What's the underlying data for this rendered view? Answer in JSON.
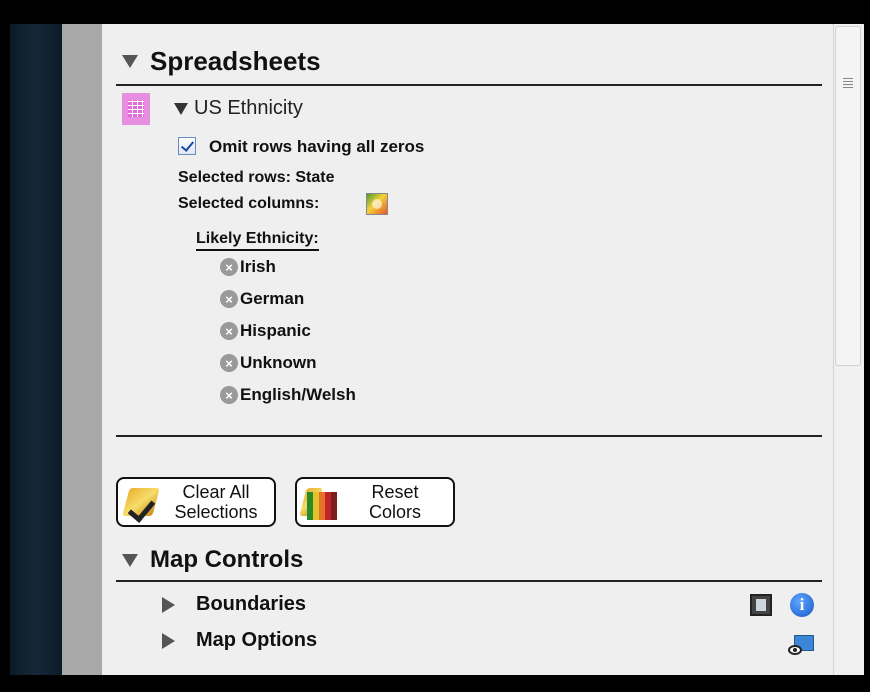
{
  "spreadsheets": {
    "title": "Spreadsheets",
    "sheet_name": "US Ethnicity",
    "omit_zeros_label": "Omit rows having all zeros",
    "omit_zeros_checked": true,
    "selected_rows": "Selected rows: State",
    "selected_columns": "Selected columns:",
    "likely_ethnicity_label": "Likely Ethnicity:",
    "ethnicities": [
      "Irish",
      "German",
      "Hispanic",
      "Unknown",
      "English/Welsh"
    ],
    "remove_glyph": "×"
  },
  "buttons": {
    "clear_line1": "Clear All",
    "clear_line2": "Selections",
    "reset_line1": "Reset",
    "reset_line2": "Colors"
  },
  "map_controls": {
    "title": "Map Controls",
    "items": [
      "Boundaries",
      "Map Options"
    ],
    "info_glyph": "i"
  },
  "colors": {
    "highlight_pink": "#e58ee2",
    "info_blue": "#1757c8",
    "panel_bg": "#efefef"
  }
}
